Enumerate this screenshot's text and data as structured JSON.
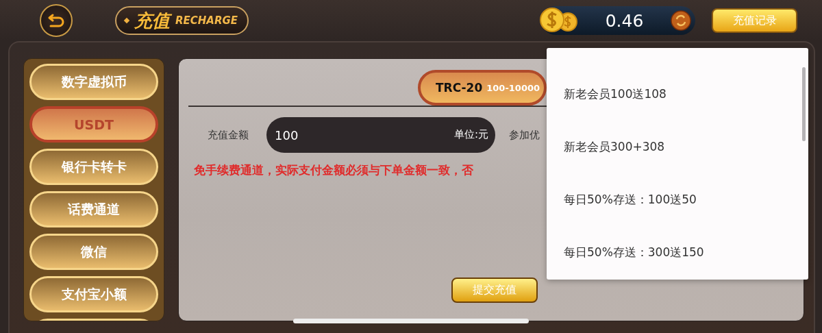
{
  "header": {
    "title": "充值",
    "title_en": "RECHARGE"
  },
  "balance": {
    "amount": "0.46"
  },
  "record_button": "充值记录",
  "sidebar": {
    "items": [
      {
        "label": "数字虚拟币",
        "selected": false
      },
      {
        "label": "USDT",
        "selected": true
      },
      {
        "label": "银行卡转卡",
        "selected": false
      },
      {
        "label": "话费通道",
        "selected": false
      },
      {
        "label": "微信",
        "selected": false
      },
      {
        "label": "支付宝小额",
        "selected": false
      }
    ]
  },
  "channel_tab": {
    "name": "TRC-20",
    "range": "100-10000",
    "selected": true
  },
  "amount": {
    "label": "充值金额",
    "value": "100",
    "unit": "单位:元"
  },
  "promo_label": "参加优",
  "notice": "免手续费通道，实际支付金额必须与下单金额一致，否",
  "submit_button": "提交充值",
  "dropdown": {
    "options": [
      {
        "label": "新老会员100送108"
      },
      {
        "label": "新老会员300+308"
      },
      {
        "label": "每日50%存送：100送50"
      },
      {
        "label": "每日50%存送：300送150"
      }
    ]
  }
}
